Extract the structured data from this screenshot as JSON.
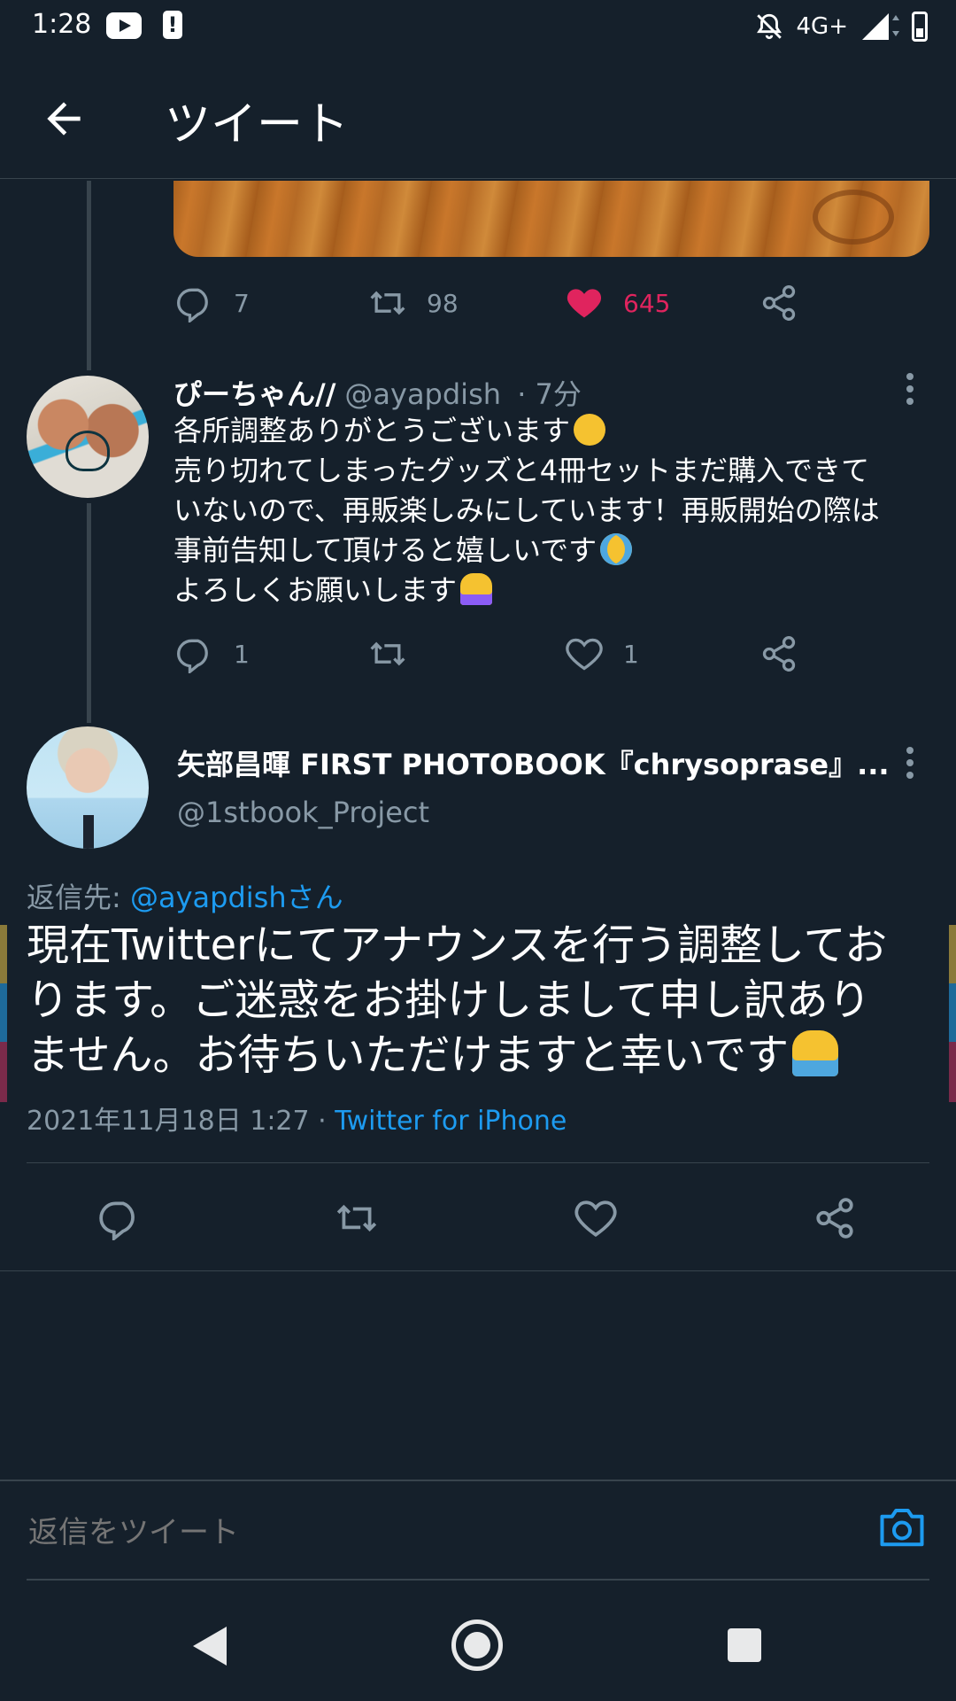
{
  "status_bar": {
    "time": "1:28",
    "network": "4G+",
    "icons": [
      "youtube-icon",
      "alert-icon",
      "notifications-off-icon",
      "signal-icon",
      "battery-icon"
    ]
  },
  "app_bar": {
    "back_icon": "arrow-left-icon",
    "title": "ツイート"
  },
  "parent_tweet_actions": {
    "reply_count": "7",
    "retweet_count": "98",
    "like_count": "645",
    "liked": true
  },
  "reply_tweet": {
    "name": "ぴーちゃん//",
    "handle": "@ayapdish",
    "time": "· 7分",
    "lines": [
      "各所調整ありがとうございます",
      "売り切れてしまったグッズと4冊セットまだ購入できて",
      "いないので、再販楽しみにしています！再販開始の際は",
      "事前告知して頂けると嬉しいです",
      "よろしくお願いします"
    ],
    "reply_count": "1",
    "retweet_count": "",
    "like_count": "1"
  },
  "main_tweet": {
    "name": "矢部昌暉 FIRST PHOTOBOOK『chrysoprase』...",
    "handle": "@1stbook_Project",
    "reply_label": "返信先: ",
    "reply_mention": "@ayapdishさん",
    "lines": [
      "現在Twitterにてアナウンスを行う調整してお",
      "ります。ご迷惑をお掛けしまして申し訳あり",
      "ません。お待ちいただけますと幸いです"
    ],
    "timestamp": "2021年11月18日 1:27 · ",
    "client": "Twitter for iPhone"
  },
  "reply_bar": {
    "placeholder": "返信をツイート"
  },
  "colors": {
    "background": "#15202b",
    "accent": "#1d9bf0",
    "like": "#e0245e",
    "muted": "#8899a6",
    "divider": "#38444d"
  }
}
